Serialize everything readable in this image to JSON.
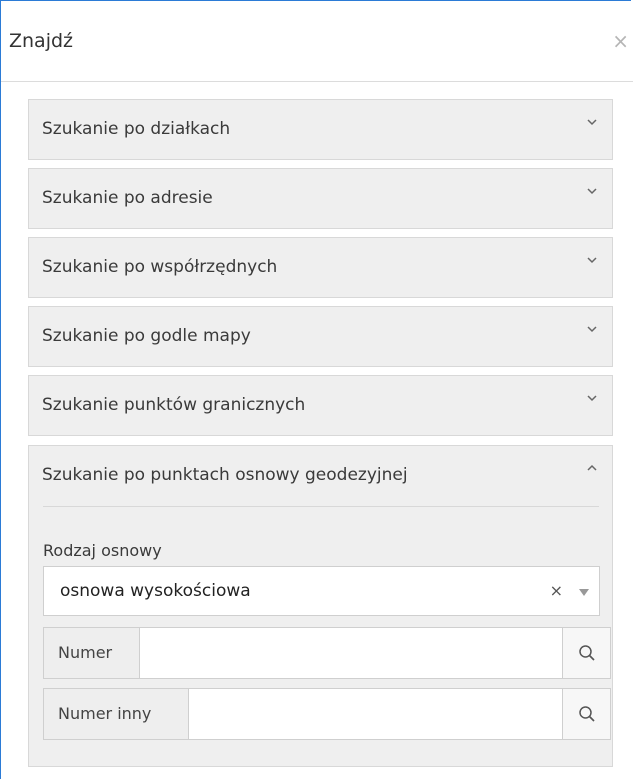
{
  "panel": {
    "title": "Znajdź",
    "close_glyph": "×"
  },
  "accordion": {
    "items": [
      {
        "label": "Szukanie po działkach",
        "expanded": false
      },
      {
        "label": "Szukanie po adresie",
        "expanded": false
      },
      {
        "label": "Szukanie po współrzędnych",
        "expanded": false
      },
      {
        "label": "Szukanie po godle mapy",
        "expanded": false
      },
      {
        "label": "Szukanie punktów granicznych",
        "expanded": false
      }
    ],
    "open_section": {
      "label": "Szukanie po punktach osnowy geodezyjnej",
      "expanded": true,
      "field_label": "Rodzaj osnowy",
      "select_value": "osnowa wysokościowa",
      "select_clear_glyph": "×",
      "inputs": [
        {
          "addon": "Numer",
          "value": ""
        },
        {
          "addon": "Numer inny",
          "value": ""
        }
      ]
    }
  },
  "colors": {
    "panel_border": "#2b7bd6",
    "accordion_bg": "#efefef",
    "border": "#d8d8d8",
    "close_icon": "#b5b5b5"
  },
  "icons": {
    "close": "close-icon",
    "chevron_down": "chevron-down-icon",
    "chevron_up": "chevron-up-icon",
    "dropdown_arrow": "dropdown-arrow-icon",
    "search": "search-icon"
  }
}
